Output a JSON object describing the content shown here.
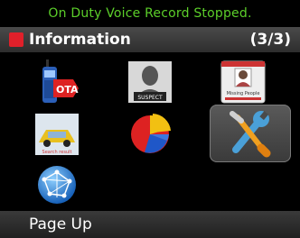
{
  "status": {
    "text": "On Duty Voice Record Stopped."
  },
  "header": {
    "title": "Information",
    "page_indicator": "(3/3)"
  },
  "tiles": [
    {
      "name": "ota",
      "icon": "radio-ota-icon",
      "label": "OTA"
    },
    {
      "name": "suspect",
      "icon": "suspect-photo-icon",
      "label": "SUSPECT"
    },
    {
      "name": "missing-people",
      "icon": "missing-people-card-icon",
      "label": "Missing People"
    },
    {
      "name": "vehicle",
      "icon": "vehicle-icon",
      "label": "Search result"
    },
    {
      "name": "pie-chart",
      "icon": "pie-chart-icon"
    },
    {
      "name": "settings",
      "icon": "tools-icon",
      "selected": true
    },
    {
      "name": "globe",
      "icon": "globe-icon"
    }
  ],
  "softkeys": {
    "left": "Page Up"
  },
  "colors": {
    "status_text": "#5ccf2a",
    "title_marker": "#e0202a",
    "background": "#000000"
  }
}
